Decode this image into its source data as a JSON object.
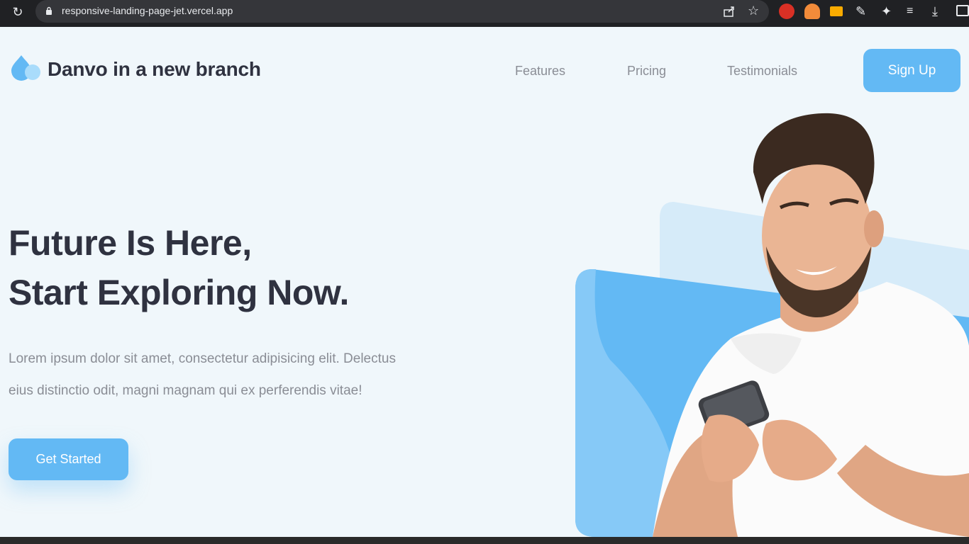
{
  "browser": {
    "url": "responsive-landing-page-jet.vercel.app",
    "icons": [
      "reload-icon",
      "lock-icon",
      "share-icon",
      "star-icon",
      "extension-icons",
      "download-icon"
    ]
  },
  "header": {
    "brand": "Danvo in a new branch",
    "nav": {
      "features": "Features",
      "pricing": "Pricing",
      "testimonials": "Testimonials"
    },
    "signup_label": "Sign Up"
  },
  "hero": {
    "headline_line1": "Future Is Here,",
    "headline_line2": "Start Exploring Now.",
    "description_line1": "Lorem ipsum dolor sit amet, consectetur adipisicing elit. Delectus",
    "description_line2": "eius distinctio odit, magni magnam qui ex perferendis vitae!",
    "cta_label": "Get Started"
  },
  "colors": {
    "accent": "#63b9f4",
    "background": "#f0f7fb",
    "heading": "#2f3240",
    "muted": "#8a8d95"
  }
}
